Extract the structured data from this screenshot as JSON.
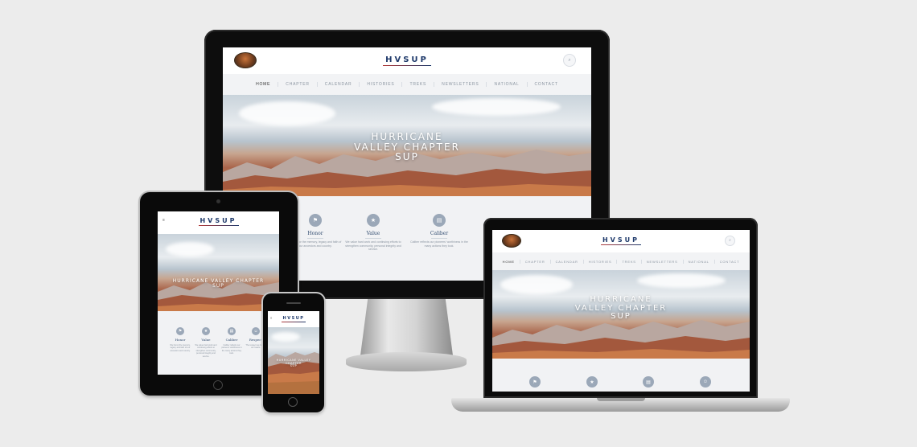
{
  "site": {
    "brand": "HVSUP",
    "search_icon": "magnifier-icon",
    "nav": [
      "HOME",
      "CHAPTER",
      "CALENDAR",
      "HISTORIES",
      "TREKS",
      "NEWSLETTERS",
      "NATIONAL",
      "CONTACT"
    ],
    "hero_line1": "HURRICANE",
    "hero_line2": "VALLEY CHAPTER",
    "hero_line3": "SUP",
    "values": [
      {
        "title": "Honor",
        "text": "We honor the memory, legacy and faith of our ancestors and country.",
        "icon": "flag-icon"
      },
      {
        "title": "Value",
        "text": "We value hard work and continuing efforts to strengthen community, personal integrity and service.",
        "icon": "star-icon"
      },
      {
        "title": "Caliber",
        "text": "Caliber reflects our pioneers' worthiness in the many actions they took.",
        "icon": "book-icon"
      },
      {
        "title": "Respect",
        "text": "The respect we hold in our hearts.",
        "icon": "people-icon"
      }
    ],
    "menu_icon": "hamburger-menu-icon"
  },
  "colors": {
    "background": "#ececec",
    "brand_blue": "#1f3a6b",
    "icon_grey": "#9ba8b8",
    "nav_bg": "#f2f3f5"
  }
}
